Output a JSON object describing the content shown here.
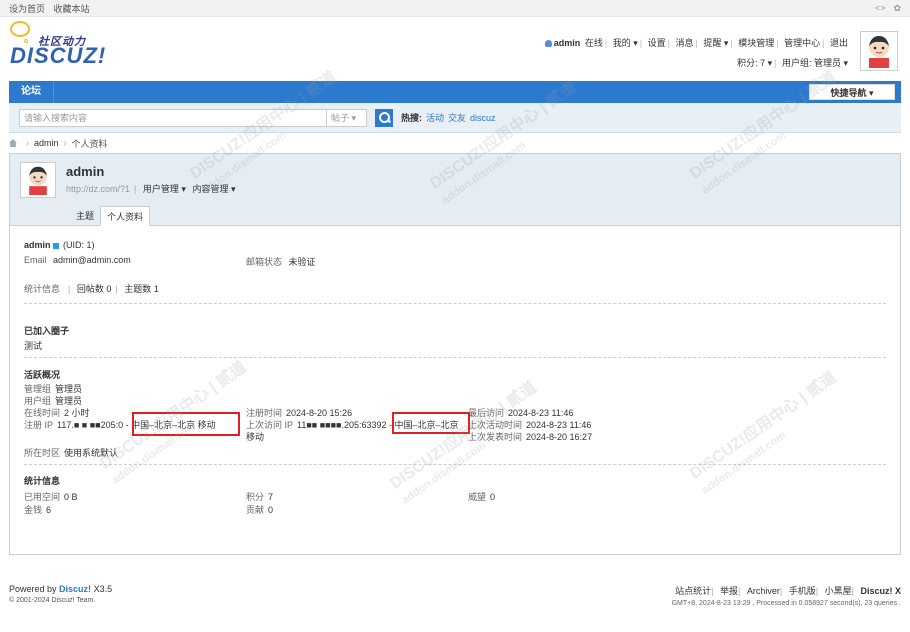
{
  "topbar": {
    "links": [
      "设为首页",
      "收藏本站"
    ],
    "icons": [
      "code-icon",
      "settings-icon"
    ]
  },
  "logo": {
    "tagline": "社区动力",
    "wordmark": "DISCUZ!"
  },
  "userbar": {
    "username": "admin",
    "status": "在线",
    "links": [
      "我的 ▾",
      "设置",
      "消息",
      "提醒 ▾",
      "模块管理",
      "管理中心",
      "退出"
    ],
    "credits": "积分: 7 ▾",
    "usergroup": "用户组: 管理员 ▾"
  },
  "nav": {
    "item": "论坛",
    "quick_nav": "快捷导航 ▾"
  },
  "search": {
    "placeholder": "请输入搜索内容",
    "type": "帖子 ▾",
    "hot_label": "热搜:",
    "hot_links": [
      "活动",
      "交友",
      "discuz"
    ]
  },
  "breadcrumb": {
    "items": [
      "admin",
      "个人资料"
    ]
  },
  "profile": {
    "name": "admin",
    "url": "http://dz.com/?1",
    "menus": [
      "用户管理 ▾",
      "内容管理 ▾"
    ],
    "tabs": [
      "主题",
      "个人资料"
    ],
    "active_tab": "个人资料"
  },
  "details": {
    "uid_line": "(UID: 1)",
    "email_label": "Email",
    "email": "admin@admin.com",
    "mail_status_label": "邮箱状态",
    "mail_status": "未验证",
    "stats_label": "统计信息",
    "replies": "回帖数 0",
    "threads": "主题数 1",
    "groups_title": "已加入圈子",
    "groups_value": "测试",
    "activity_title": "活跃概况",
    "admin_group_label": "管理组",
    "admin_group": "管理员",
    "user_group_label": "用户组",
    "user_group": "管理员",
    "online_time_label": "在线时间",
    "online_time": "2 小时",
    "reg_ip_label": "注册 IP",
    "reg_ip": "117.■ ■ ■■205:0 - 中国–北京–北京 移动",
    "reg_time_label": "注册时间",
    "reg_time": "2024-8-20 15:26",
    "last_ip_label": "上次访问 IP",
    "last_ip": "11■■ ■■■■.205:63392 - 中国–北京–北京",
    "last_ip_isp": "移动",
    "last_visit_label": "最后访问",
    "last_visit": "2024-8-23 11:46",
    "last_active_label": "上次活动时间",
    "last_active": "2024-8-23 11:46",
    "last_post_label": "上次发表时间",
    "last_post": "2024-8-20 16:27",
    "timezone_label": "所在时区",
    "timezone": "使用系统默认",
    "stats_title": "统计信息",
    "space_label": "已用空间",
    "space": "0 B",
    "money_label": "金钱",
    "money": "6",
    "credits_label": "积分",
    "credits": "7",
    "contrib_label": "贡献",
    "contrib": "0",
    "prestige_label": "威望",
    "prestige": "0"
  },
  "footer": {
    "powered": "Powered by",
    "brand": "Discuz!",
    "version": "X3.5",
    "copyright": "© 2001-2024 Discuz! Team.",
    "links": [
      "站点统计",
      "举报",
      "Archiver",
      "手机版",
      "小黑屋"
    ],
    "brand_right": "Discuz! X",
    "gmt": "GMT+8, 2024-8-23 13:29 , Processed in 0.058927 second(s), 23 queries ."
  },
  "watermark": {
    "text": "DISCUZ!应用中心 | 贰道",
    "sub": "addon.dismall.com"
  }
}
